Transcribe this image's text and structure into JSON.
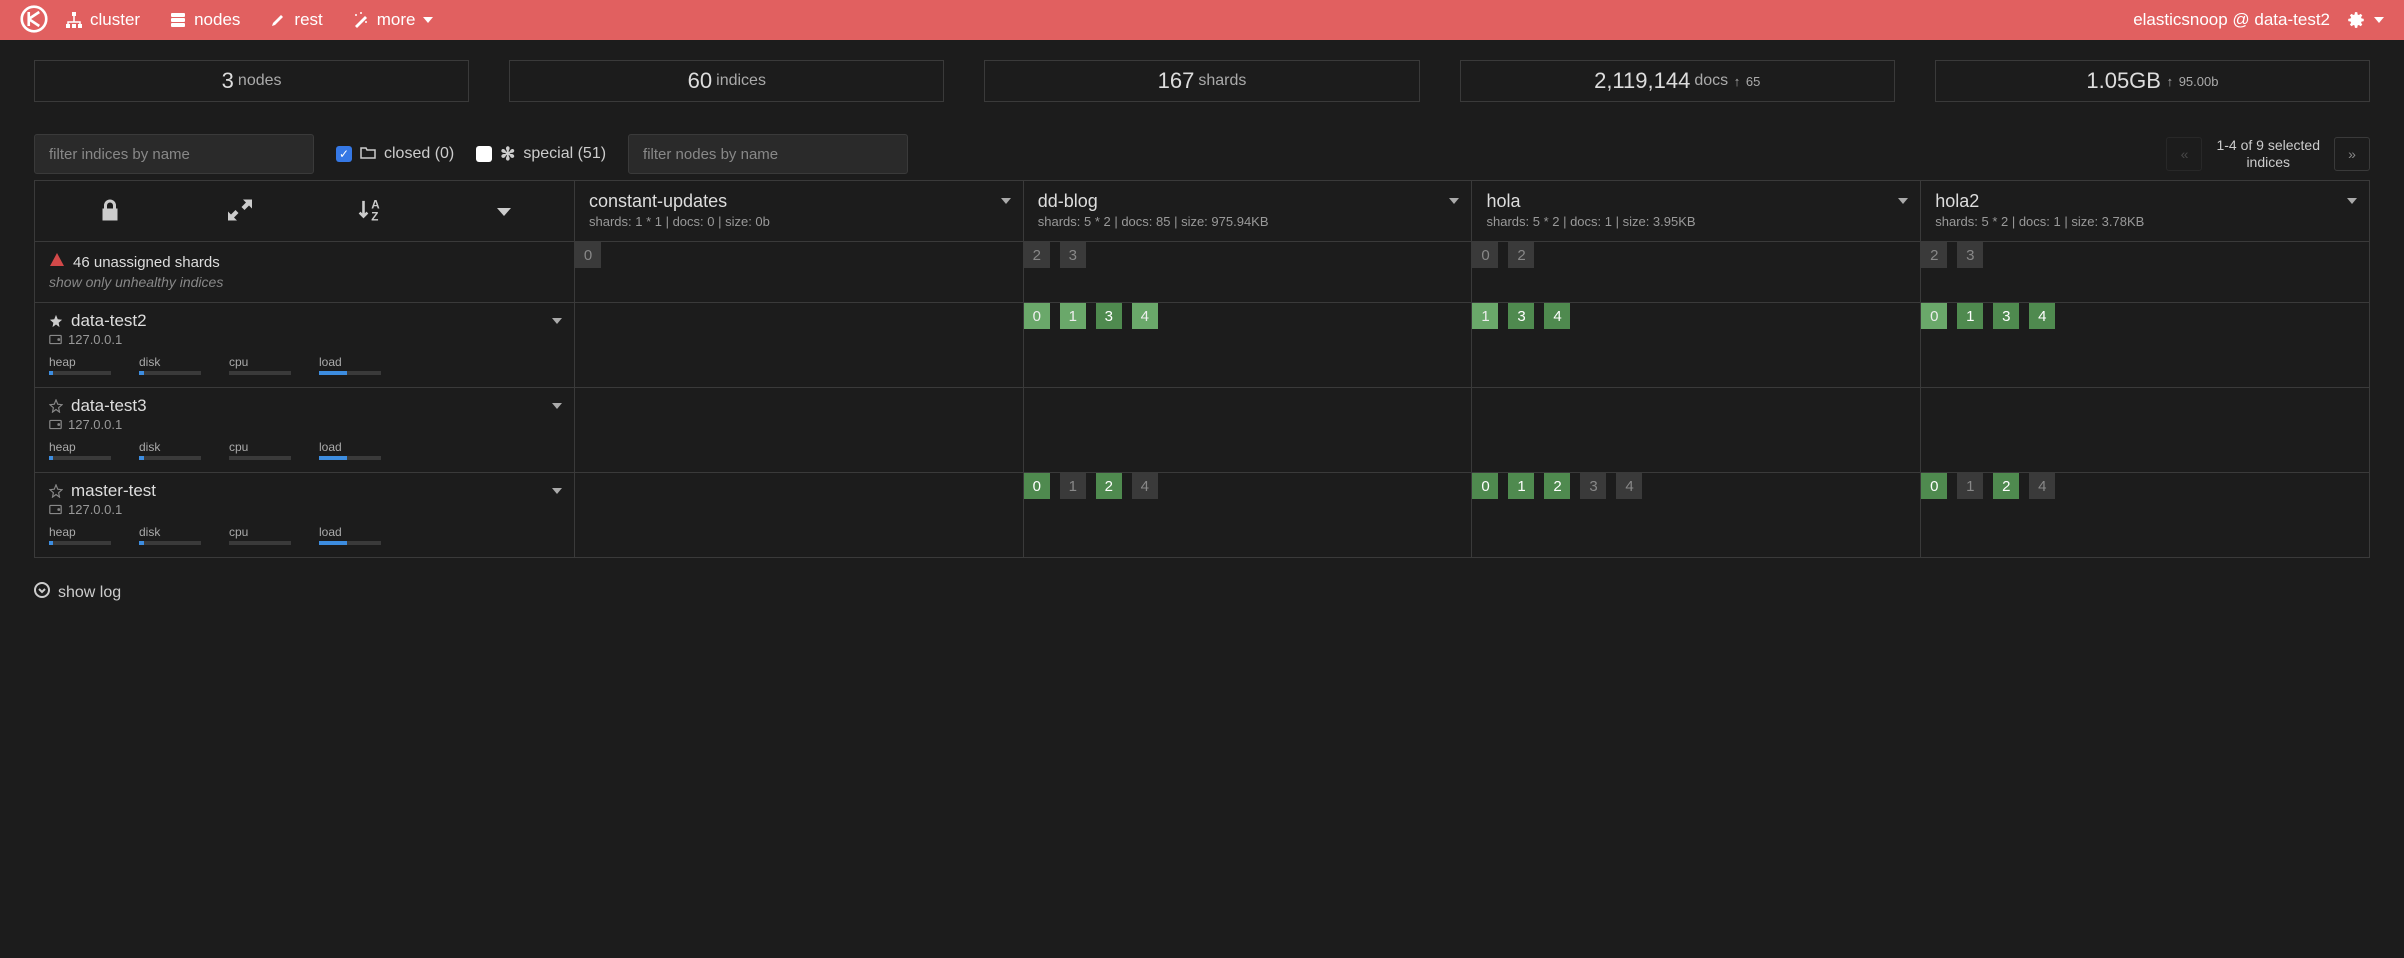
{
  "nav": {
    "cluster_label": "cluster",
    "nodes_label": "nodes",
    "rest_label": "rest",
    "more_label": "more",
    "user_text": "elasticsnoop @ data-test2"
  },
  "stats": {
    "nodes": {
      "value": "3",
      "label": "nodes"
    },
    "indices": {
      "value": "60",
      "label": "indices"
    },
    "shards": {
      "value": "167",
      "label": "shards"
    },
    "docs": {
      "value": "2,119,144",
      "label": "docs",
      "sub": "65"
    },
    "size": {
      "value": "1.05GB",
      "sub": "95.00b"
    }
  },
  "filters": {
    "indices_placeholder": "filter indices by name",
    "nodes_placeholder": "filter nodes by name",
    "closed_label": "closed (0)",
    "special_label": "special (51)",
    "pager_line1": "1-4 of 9 selected",
    "pager_line2": "indices"
  },
  "unassigned": {
    "text": "46 unassigned shards",
    "hint": "show only unhealthy indices"
  },
  "index_headers": [
    {
      "name": "constant-updates",
      "meta": "shards: 1 * 1 | docs: 0 | size: 0b"
    },
    {
      "name": "dd-blog",
      "meta": "shards: 5 * 2 | docs: 85 | size: 975.94KB"
    },
    {
      "name": "hola",
      "meta": "shards: 5 * 2 | docs: 1 | size: 3.95KB"
    },
    {
      "name": "hola2",
      "meta": "shards: 5 * 2 | docs: 1 | size: 3.78KB"
    }
  ],
  "unassigned_shards": [
    [
      {
        "n": "0",
        "cls": "sh-un"
      }
    ],
    [
      {
        "n": "2",
        "cls": "sh-un"
      },
      {
        "n": "3",
        "cls": "sh-un"
      }
    ],
    [
      {
        "n": "0",
        "cls": "sh-un"
      },
      {
        "n": "2",
        "cls": "sh-un"
      }
    ],
    [
      {
        "n": "2",
        "cls": "sh-un"
      },
      {
        "n": "3",
        "cls": "sh-un"
      }
    ]
  ],
  "nodes": [
    {
      "name": "data-test2",
      "ip": "127.0.0.1",
      "master": true,
      "stats": [
        {
          "l": "heap",
          "p": 6
        },
        {
          "l": "disk",
          "p": 8
        },
        {
          "l": "cpu",
          "p": 0
        },
        {
          "l": "load",
          "p": 45
        }
      ],
      "shards": [
        [],
        [
          {
            "n": "0",
            "cls": "sh-rep"
          },
          {
            "n": "1",
            "cls": "sh-rep"
          },
          {
            "n": "3",
            "cls": "sh-pri"
          },
          {
            "n": "4",
            "cls": "sh-rep"
          }
        ],
        [
          {
            "n": "1",
            "cls": "sh-rep"
          },
          {
            "n": "3",
            "cls": "sh-pri"
          },
          {
            "n": "4",
            "cls": "sh-pri"
          }
        ],
        [
          {
            "n": "0",
            "cls": "sh-rep"
          },
          {
            "n": "1",
            "cls": "sh-pri"
          },
          {
            "n": "3",
            "cls": "sh-pri"
          },
          {
            "n": "4",
            "cls": "sh-pri"
          }
        ]
      ]
    },
    {
      "name": "data-test3",
      "ip": "127.0.0.1",
      "master": false,
      "stats": [
        {
          "l": "heap",
          "p": 6
        },
        {
          "l": "disk",
          "p": 8
        },
        {
          "l": "cpu",
          "p": 0
        },
        {
          "l": "load",
          "p": 45
        }
      ],
      "shards": [
        [],
        [],
        [],
        []
      ]
    },
    {
      "name": "master-test",
      "ip": "127.0.0.1",
      "master": false,
      "stats": [
        {
          "l": "heap",
          "p": 6
        },
        {
          "l": "disk",
          "p": 8
        },
        {
          "l": "cpu",
          "p": 0
        },
        {
          "l": "load",
          "p": 45
        }
      ],
      "shards": [
        [],
        [
          {
            "n": "0",
            "cls": "sh-pri"
          },
          {
            "n": "1",
            "cls": "sh-repdim"
          },
          {
            "n": "2",
            "cls": "sh-pri"
          },
          {
            "n": "4",
            "cls": "sh-repdim"
          }
        ],
        [
          {
            "n": "0",
            "cls": "sh-pri"
          },
          {
            "n": "1",
            "cls": "sh-pri"
          },
          {
            "n": "2",
            "cls": "sh-pri"
          },
          {
            "n": "3",
            "cls": "sh-repdim"
          },
          {
            "n": "4",
            "cls": "sh-repdim"
          }
        ],
        [
          {
            "n": "0",
            "cls": "sh-pri"
          },
          {
            "n": "1",
            "cls": "sh-repdim"
          },
          {
            "n": "2",
            "cls": "sh-pri"
          },
          {
            "n": "4",
            "cls": "sh-repdim"
          }
        ]
      ]
    }
  ],
  "log_label": "show log"
}
